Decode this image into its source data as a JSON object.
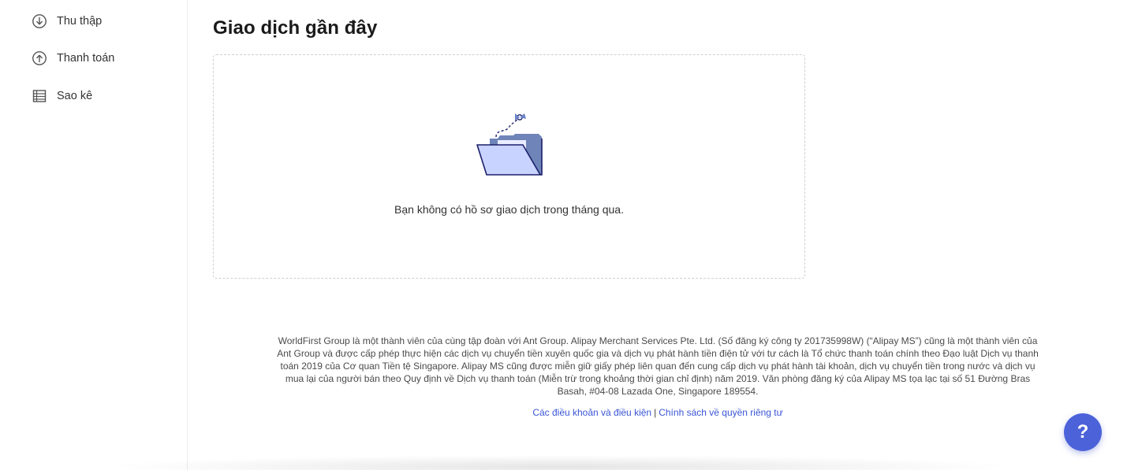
{
  "sidebar": {
    "items": [
      {
        "label": "Thu thập",
        "icon": "arrow-down-circle-icon"
      },
      {
        "label": "Thanh toán",
        "icon": "arrow-up-circle-icon"
      },
      {
        "label": "Sao kê",
        "icon": "table-icon"
      }
    ]
  },
  "main": {
    "title": "Giao dịch gần đây",
    "empty_state": {
      "message": "Bạn không có hồ sơ giao dịch trong tháng qua.",
      "illustration": "empty-folder-icon"
    }
  },
  "footer": {
    "legal_text": "WorldFirst Group là một thành viên của cùng tập đoàn với Ant Group. Alipay Merchant Services Pte. Ltd. (Số đăng ký công ty 201735998W) (“Alipay MS”) cũng là một thành viên của Ant Group và được cấp phép thực hiện các dịch vụ chuyển tiền xuyên quốc gia và dịch vụ phát hành tiền điện tử với tư cách là Tổ chức thanh toán chính theo Đạo luật Dịch vụ thanh toán 2019 của Cơ quan Tiền tệ Singapore. Alipay MS cũng được miễn giữ giấy phép liên quan đến cung cấp dịch vụ phát hành tài khoản, dịch vụ chuyển tiền trong nước và dịch vụ mua lại của người bán theo Quy định về Dịch vụ thanh toán (Miễn trừ trong khoảng thời gian chỉ định) năm 2019. Văn phòng đăng ký của Alipay MS tọa lạc tại số 51 Đường Bras Basah, #04-08 Lazada One, Singapore 189554.",
    "links": {
      "terms": "Các điều khoản và điều kiện",
      "separator": "|",
      "privacy": "Chính sách về quyền riêng tư"
    }
  },
  "help_button": {
    "label": "?"
  },
  "colors": {
    "accent": "#4b62d9",
    "link": "#3a55d6",
    "illustration_fill": "#c9d3ff",
    "illustration_dark": "#1b1f6b"
  }
}
